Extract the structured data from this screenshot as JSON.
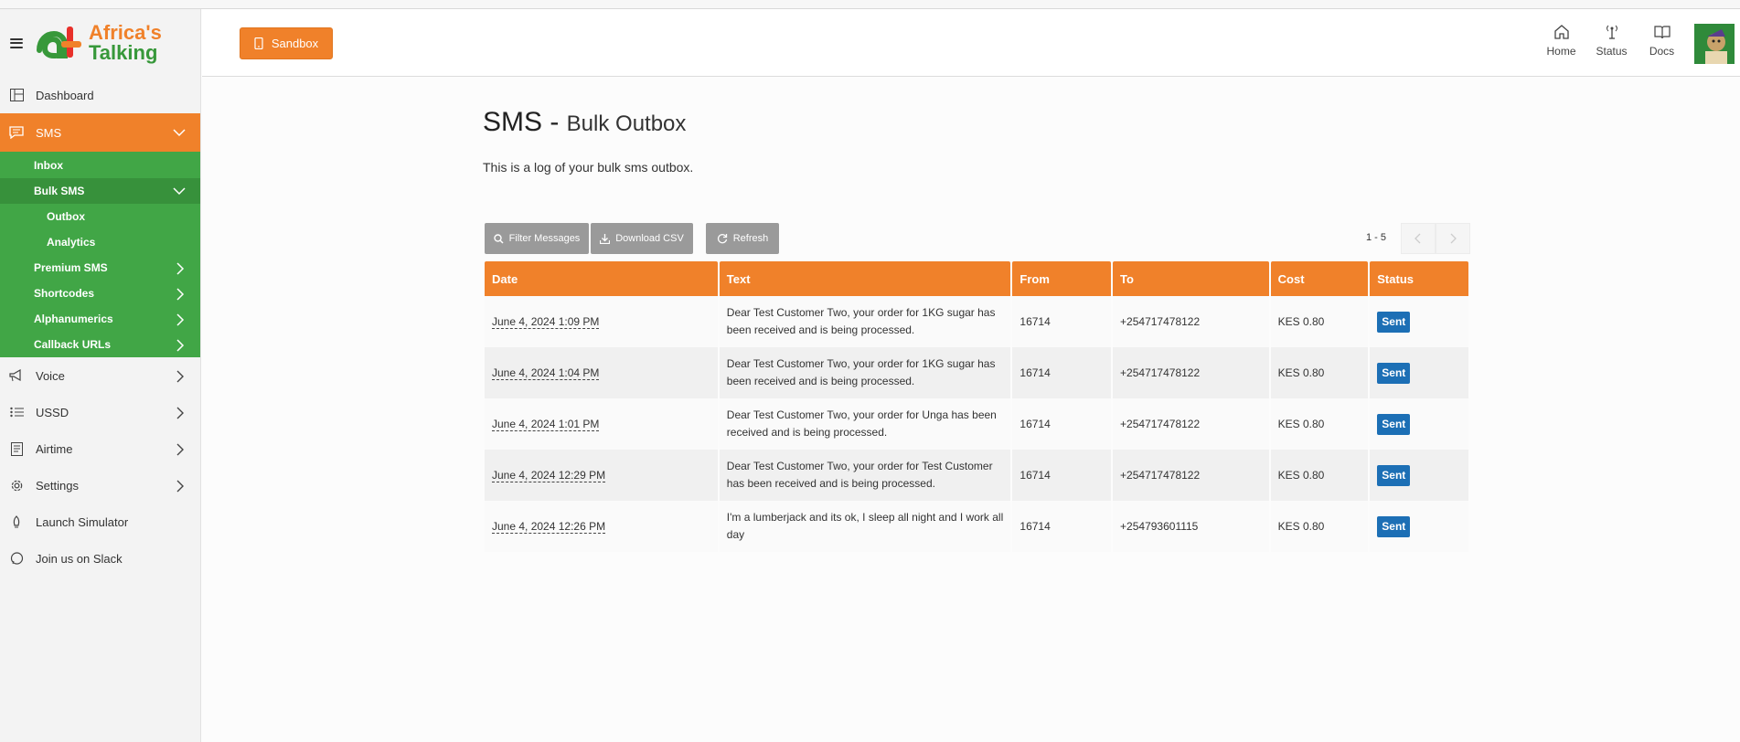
{
  "brand": {
    "line1": "Africa's",
    "line2": "Talking"
  },
  "sidebar": {
    "items": [
      {
        "label": "Dashboard",
        "icon": "dashboard-icon"
      },
      {
        "label": "SMS",
        "icon": "sms-icon"
      },
      {
        "label": "Voice",
        "icon": "megaphone-icon"
      },
      {
        "label": "USSD",
        "icon": "list-icon"
      },
      {
        "label": "Airtime",
        "icon": "receipt-icon"
      },
      {
        "label": "Settings",
        "icon": "gear-icon"
      },
      {
        "label": "Launch Simulator",
        "icon": "rocket-icon"
      },
      {
        "label": "Join us on Slack",
        "icon": "chat-icon"
      }
    ],
    "sms_sub": {
      "inbox": "Inbox",
      "bulk_sms": "Bulk SMS",
      "outbox": "Outbox",
      "analytics": "Analytics",
      "premium_sms": "Premium SMS",
      "shortcodes": "Shortcodes",
      "alphanumerics": "Alphanumerics",
      "callback_urls": "Callback URLs"
    }
  },
  "header": {
    "sandbox_label": "Sandbox",
    "links": [
      {
        "label": "Home",
        "icon": "home-icon"
      },
      {
        "label": "Status",
        "icon": "antenna-icon"
      },
      {
        "label": "Docs",
        "icon": "book-icon"
      }
    ]
  },
  "main": {
    "title": "SMS - ",
    "subtitle": "Bulk Outbox",
    "intro": "This is a log of your bulk sms outbox.",
    "toolbar": {
      "filter": "Filter Messages",
      "download": "Download CSV",
      "refresh": "Refresh",
      "range": "1 - 5"
    },
    "table": {
      "headers": [
        "Date",
        "Text",
        "From",
        "To",
        "Cost",
        "Status"
      ],
      "rows": [
        {
          "date": "June 4, 2024 1:09 PM",
          "text": "Dear Test Customer Two, your order for 1KG sugar has been received and is being processed.",
          "from": "16714",
          "to": "+254717478122",
          "cost": "KES 0.80",
          "status": "Sent"
        },
        {
          "date": "June 4, 2024 1:04 PM",
          "text": "Dear Test Customer Two, your order for 1KG sugar has been received and is being processed.",
          "from": "16714",
          "to": "+254717478122",
          "cost": "KES 0.80",
          "status": "Sent"
        },
        {
          "date": "June 4, 2024 1:01 PM",
          "text": "Dear Test Customer Two, your order for Unga has been received and is being processed.",
          "from": "16714",
          "to": "+254717478122",
          "cost": "KES 0.80",
          "status": "Sent"
        },
        {
          "date": "June 4, 2024 12:29 PM",
          "text": "Dear Test Customer Two, your order for Test Customer has been received and is being processed.",
          "from": "16714",
          "to": "+254717478122",
          "cost": "KES 0.80",
          "status": "Sent"
        },
        {
          "date": "June 4, 2024 12:26 PM",
          "text": "I'm a lumberjack and its ok, I sleep all night and I work all day",
          "from": "16714",
          "to": "+254793601115",
          "cost": "KES 0.80",
          "status": "Sent"
        }
      ]
    }
  },
  "colors": {
    "accent": "#f0812a",
    "green": "#41a646",
    "badge": "#1c6fb5"
  }
}
